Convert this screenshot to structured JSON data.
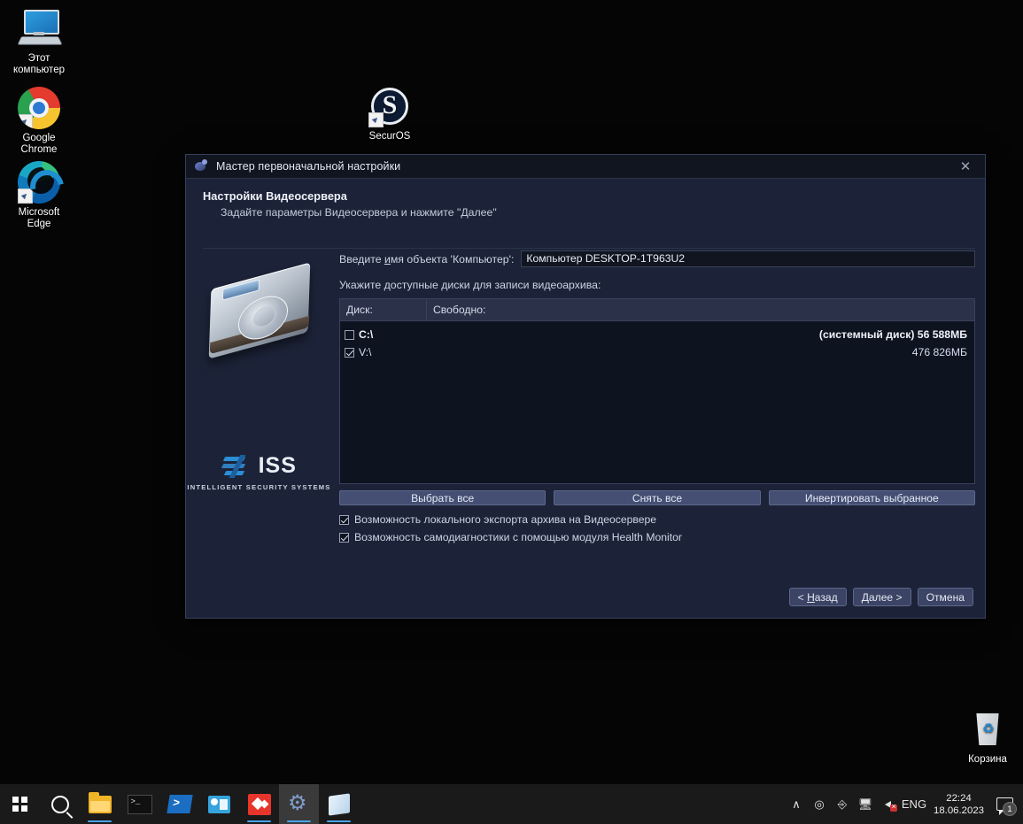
{
  "desktop": {
    "icons": [
      {
        "name": "this-pc",
        "label": "Этот\nкомпьютер",
        "label_line1": "Этот",
        "label_line2": "компьютер"
      },
      {
        "name": "google-chrome",
        "label": "Google Chrome",
        "label_line1": "Google",
        "label_line2": "Chrome"
      },
      {
        "name": "microsoft-edge",
        "label": "Microsoft Edge",
        "label_line1": "Microsoft",
        "label_line2": "Edge"
      },
      {
        "name": "securos",
        "label": "SecurOS"
      },
      {
        "name": "recycle-bin",
        "label": "Корзина"
      }
    ]
  },
  "dialog": {
    "title": "Мастер первоначальной настройки",
    "close_glyph": "✕",
    "header": {
      "title": "Настройки Видеосервера",
      "subtitle": "Задайте параметры Видеосервера и нажмите \"Далее\""
    },
    "branding": {
      "logo_word": "ISS",
      "tagline": "INTELLIGENT SECURITY SYSTEMS"
    },
    "name_field": {
      "label_pre": "Введите ",
      "label_mnemonic": "и",
      "label_post": "мя объекта 'Компьютер':",
      "value": "Компьютер DESKTOP-1T963U2"
    },
    "disks_label": "Укажите доступные диски для записи видеоархива:",
    "table": {
      "columns": [
        "Диск:",
        "Свободно:"
      ],
      "rows": [
        {
          "checked": false,
          "drive": "C:\\",
          "free": "(системный диск) 56 588МБ",
          "bold": true
        },
        {
          "checked": true,
          "drive": "V:\\",
          "free": "476 826МБ",
          "bold": false
        }
      ]
    },
    "select_buttons": [
      {
        "name": "select-all",
        "label": "Выбрать все"
      },
      {
        "name": "deselect-all",
        "label": "Снять все"
      },
      {
        "name": "invert-selection",
        "label": "Инвертировать выбранное"
      }
    ],
    "options": [
      {
        "name": "local-export",
        "checked": true,
        "label": "Возможность локального экспорта архива на Видеосервере"
      },
      {
        "name": "health-monitor",
        "checked": true,
        "label": "Возможность самодиагностики с помощью модуля Health Monitor"
      }
    ],
    "nav": {
      "back_pre": "< ",
      "back_mnemonic": "Н",
      "back_post": "азад",
      "next_pre": "",
      "next_mnemonic": "Д",
      "next_post": "алее >",
      "cancel": "Отмена"
    }
  },
  "taskbar": {
    "items": [
      {
        "name": "start-button",
        "icon": "windows-logo-icon"
      },
      {
        "name": "search-button",
        "icon": "search-icon"
      },
      {
        "name": "file-explorer-button",
        "icon": "folder-icon"
      },
      {
        "name": "command-prompt-button",
        "icon": "command-prompt-icon"
      },
      {
        "name": "powershell-button",
        "icon": "powershell-icon"
      },
      {
        "name": "outlook-button",
        "icon": "outlook-icon"
      },
      {
        "name": "red-app-button",
        "icon": "red-diamond-icon"
      },
      {
        "name": "securos-button",
        "icon": "gear-icon"
      },
      {
        "name": "notes-button",
        "icon": "note-icon"
      }
    ],
    "tray": {
      "chevron": "∧",
      "language": "ENG",
      "time": "22:24",
      "date": "18.06.2023",
      "notification_count": "1"
    }
  }
}
